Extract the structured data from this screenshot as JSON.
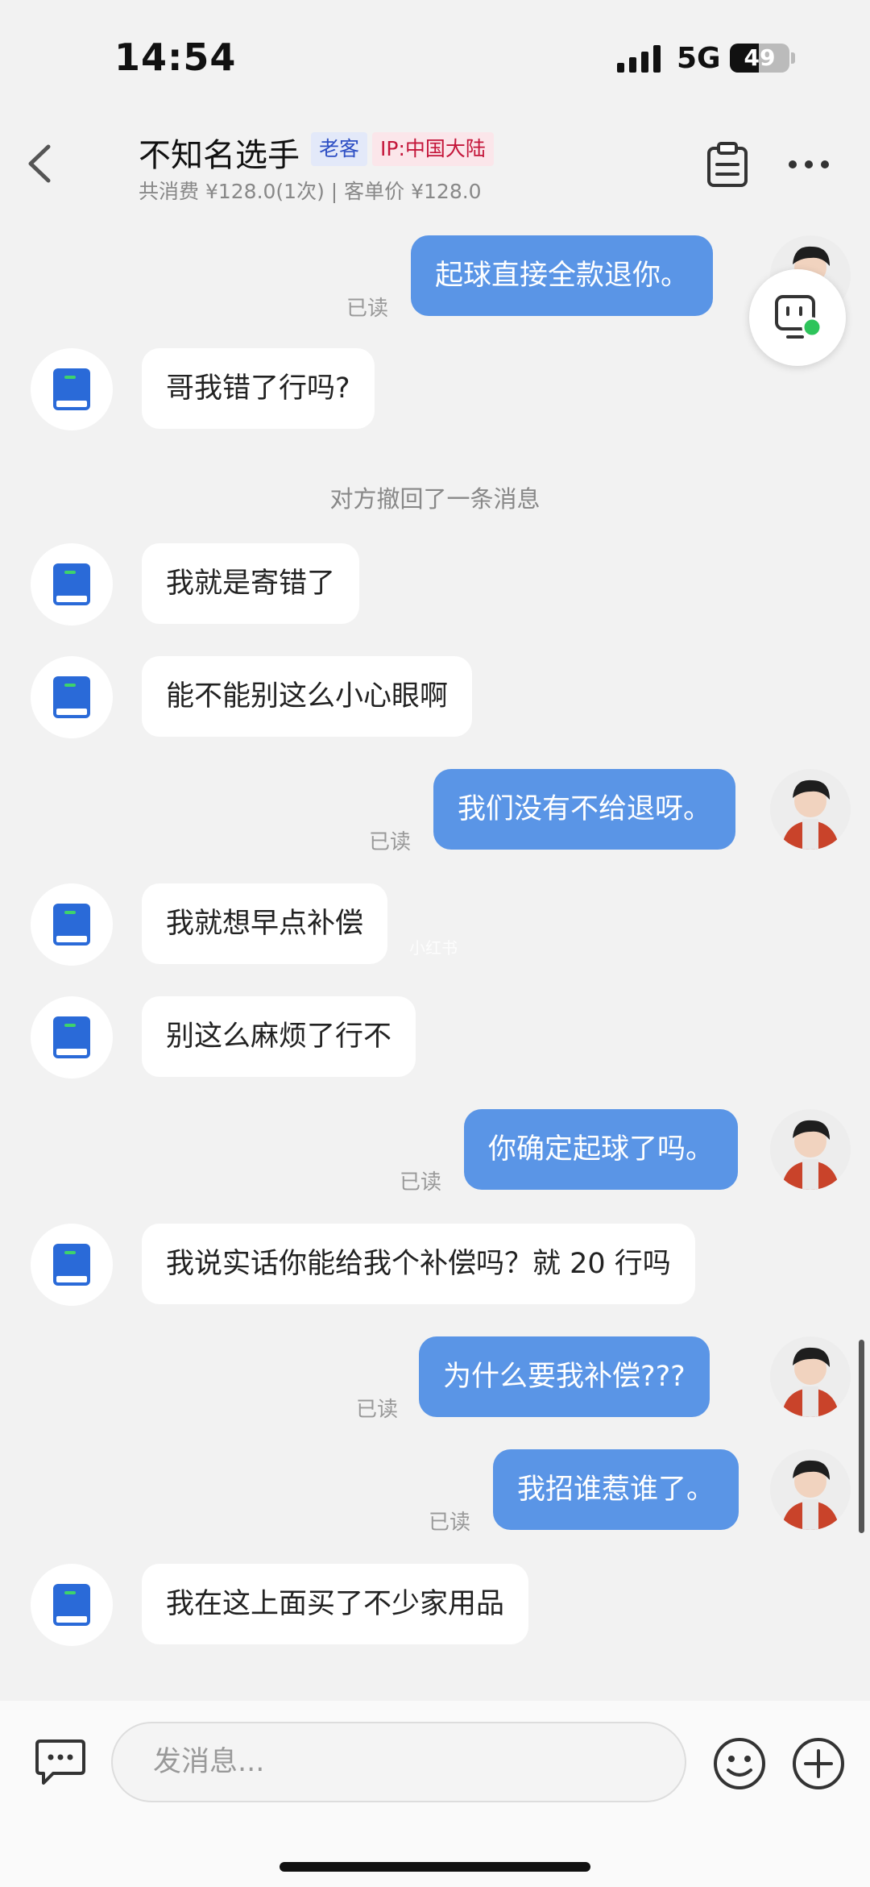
{
  "status_bar": {
    "time": "14:54",
    "network": "5G",
    "battery": "49",
    "battery_level": 0.49
  },
  "header": {
    "name": "不知名选手",
    "tags": [
      "老客",
      "IP:中国大陆"
    ],
    "summary": "共消费 ¥128.0(1次) | 客单价 ¥128.0"
  },
  "messages": [
    {
      "from": "me",
      "text": "起球直接全款退你。",
      "status": "已读"
    },
    {
      "from": "them",
      "text": "哥我错了行吗?"
    },
    {
      "from": "system",
      "text": "对方撤回了一条消息"
    },
    {
      "from": "them",
      "text": "我就是寄错了"
    },
    {
      "from": "them",
      "text": "能不能别这么小心眼啊"
    },
    {
      "from": "me",
      "text": "我们没有不给退呀。",
      "status": "已读"
    },
    {
      "from": "them",
      "text": "我就想早点补偿"
    },
    {
      "from": "them",
      "text": "别这么麻烦了行不"
    },
    {
      "from": "me",
      "text": "你确定起球了吗。",
      "status": "已读"
    },
    {
      "from": "them",
      "text": "我说实话你能给我个补偿吗？就 20 行吗"
    },
    {
      "from": "me",
      "text": "为什么要我补偿???",
      "status": "已读"
    },
    {
      "from": "me",
      "text": "我招谁惹谁了。",
      "status": "已读"
    },
    {
      "from": "them",
      "text": "我在这上面买了不少家用品"
    }
  ],
  "watermark": "小红书",
  "input": {
    "placeholder": "发消息..."
  },
  "icons": {
    "back": "back-arrow-icon",
    "clipboard": "clipboard-icon",
    "more": "more-dots-icon",
    "robot": "robot-assistant-icon",
    "chat": "chat-bubble-icon",
    "emoji": "emoji-icon",
    "plus": "plus-icon",
    "contact_avatar": "blue-book-icon"
  },
  "colors": {
    "outgoing_bubble": "#5a95e6",
    "incoming_bubble": "#ffffff",
    "background": "#f2f2f2"
  }
}
